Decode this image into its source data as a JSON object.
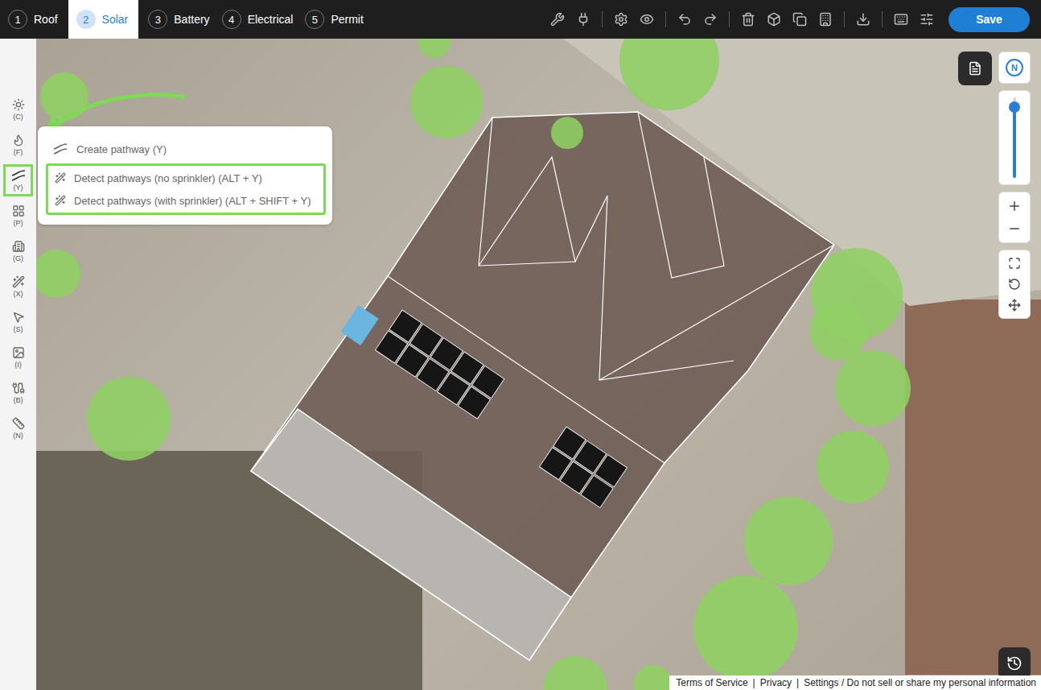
{
  "steps": [
    {
      "number": "1",
      "label": "Roof",
      "selected": false
    },
    {
      "number": "2",
      "label": "Solar",
      "selected": true
    },
    {
      "number": "3",
      "label": "Battery",
      "selected": false
    },
    {
      "number": "4",
      "label": "Electrical",
      "selected": false
    },
    {
      "number": "5",
      "label": "Permit",
      "selected": false
    }
  ],
  "save_button": "Save",
  "tools": [
    {
      "shortcut": "(C)",
      "selected": false
    },
    {
      "shortcut": "(F)",
      "selected": false
    },
    {
      "shortcut": "(Y)",
      "selected": true
    },
    {
      "shortcut": "(P)",
      "selected": false
    },
    {
      "shortcut": "(G)",
      "selected": false
    },
    {
      "shortcut": "(X)",
      "selected": false
    },
    {
      "shortcut": "(S)",
      "selected": false
    },
    {
      "shortcut": "(I)",
      "selected": false
    },
    {
      "shortcut": "(B)",
      "selected": false
    },
    {
      "shortcut": "(N)",
      "selected": false
    }
  ],
  "pathway_menu": {
    "items": [
      {
        "label": "Create pathway (Y)",
        "highlighted": false
      },
      {
        "label": "Detect pathways (no sprinkler) (ALT + Y)",
        "highlighted": true
      },
      {
        "label": "Detect pathways (with sprinkler) (ALT + SHIFT + Y)",
        "highlighted": true
      }
    ]
  },
  "compass": "N",
  "zoom": {
    "level": 0.88
  },
  "footer": {
    "links": [
      "Terms of Service",
      "Privacy",
      "Settings / Do not sell or share my personal information"
    ],
    "separator": "|"
  }
}
